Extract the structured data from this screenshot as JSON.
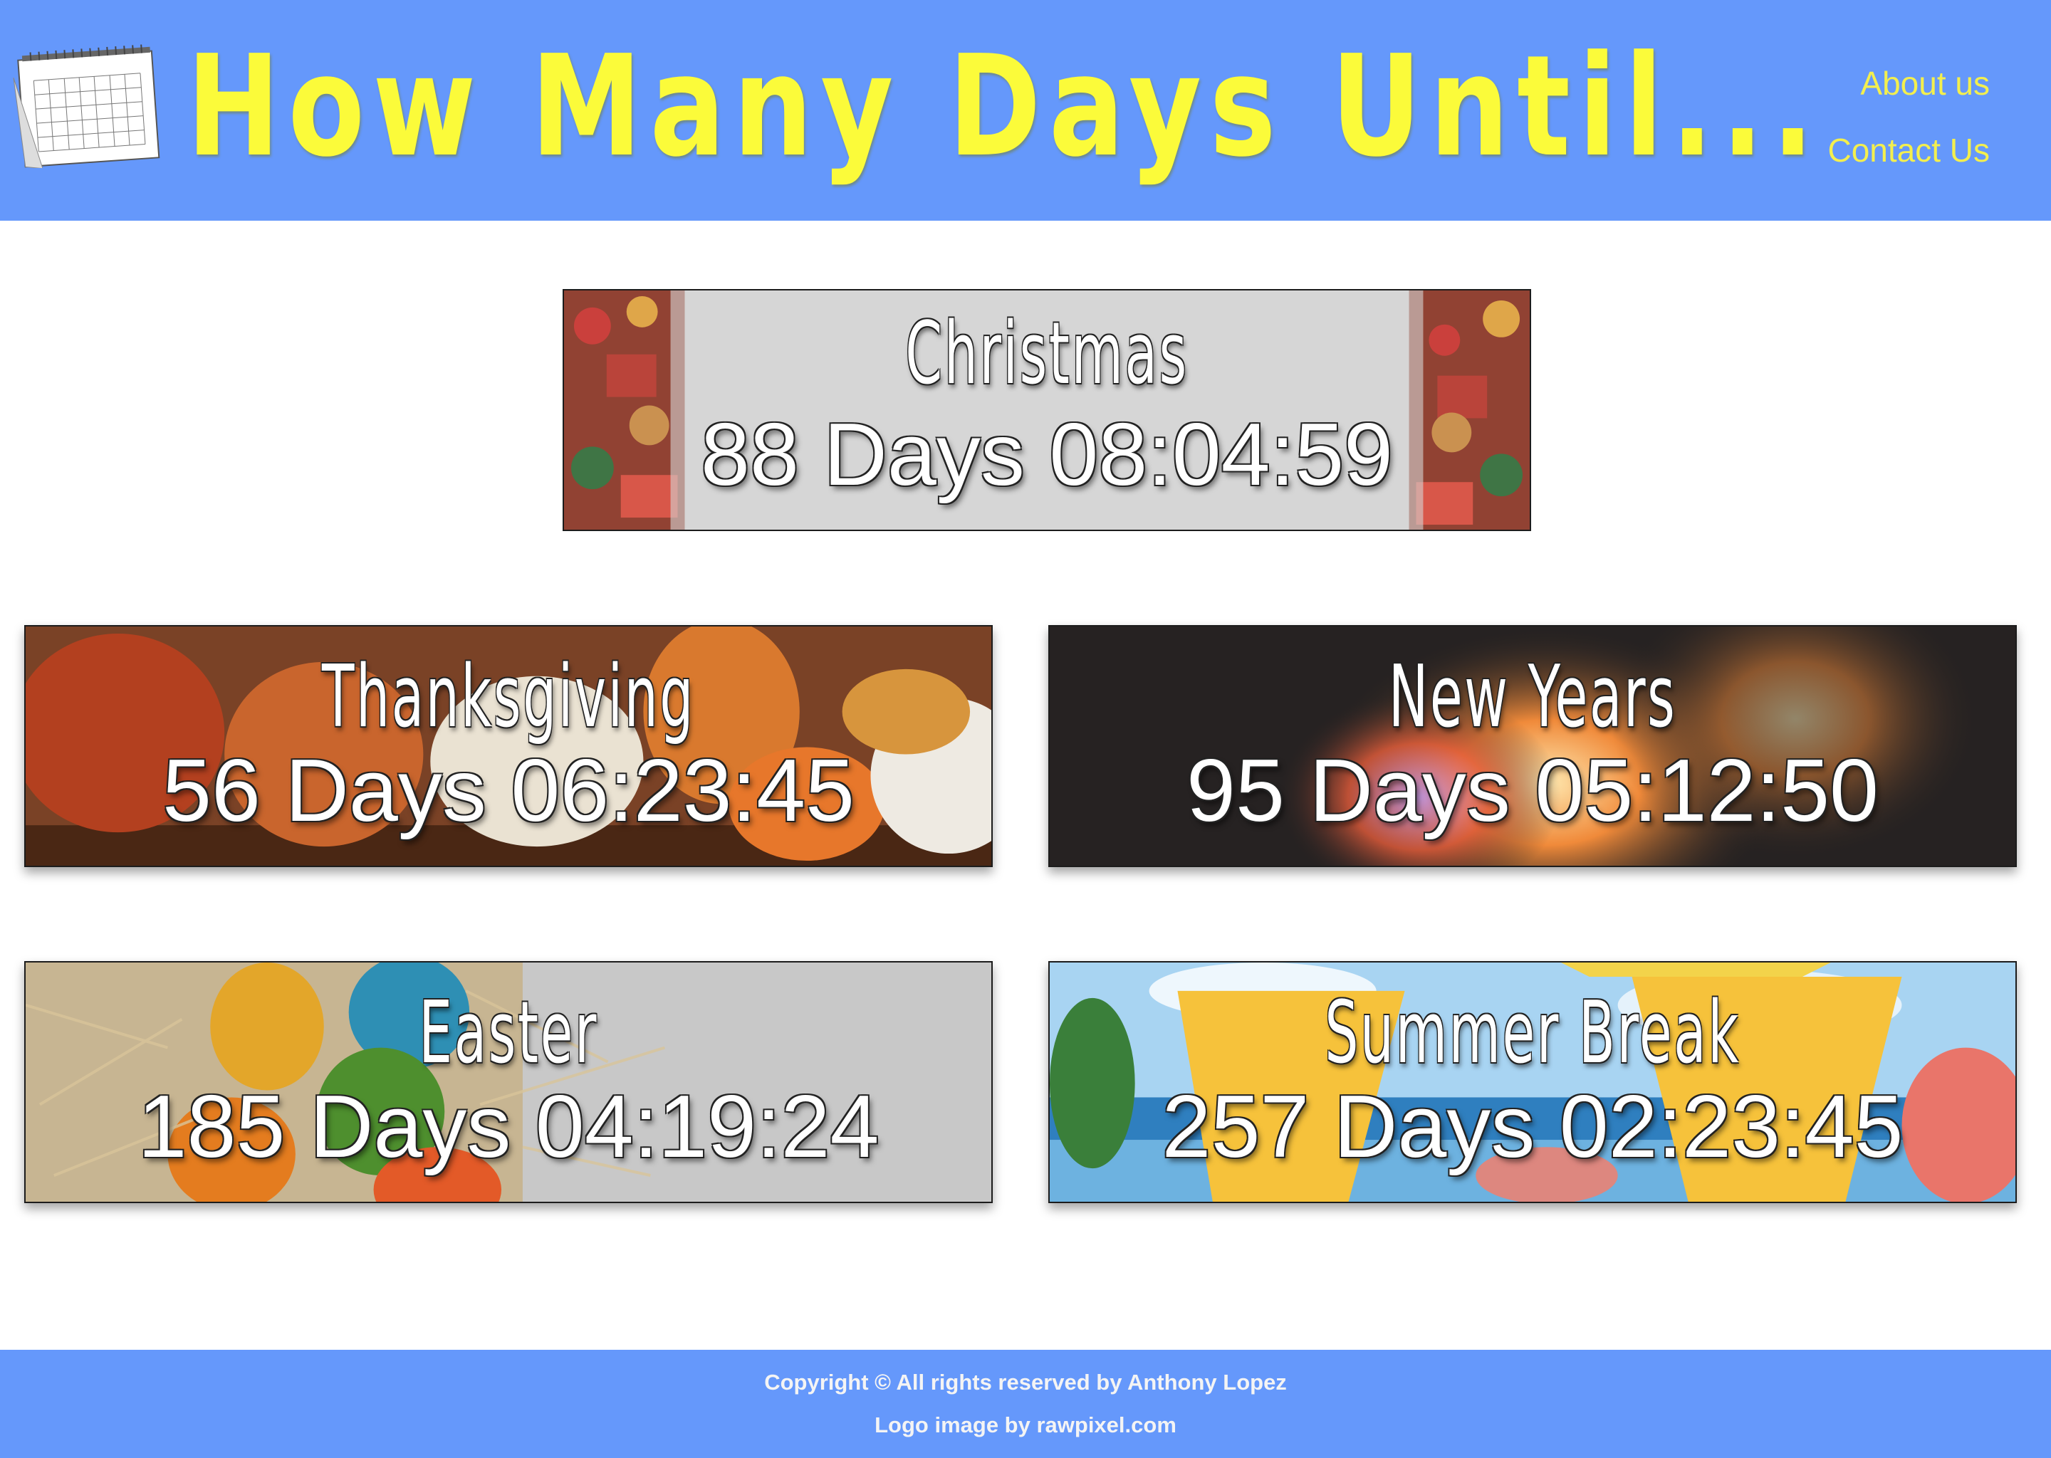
{
  "header": {
    "title": "How Many Days Until...",
    "nav": [
      {
        "label": "About us"
      },
      {
        "label": "Contact Us"
      }
    ],
    "colors": {
      "background": "#6598fb",
      "title": "#fbfb3a",
      "nav": "#f3ef4e"
    }
  },
  "cards": {
    "christmas": {
      "title": "Christmas",
      "countdown": "88 Days 08:04:59"
    },
    "thanksgiving": {
      "title": "Thanksgiving",
      "countdown": "56 Days 06:23:45"
    },
    "newyears": {
      "title": "New Years",
      "countdown": "95 Days 05:12:50"
    },
    "easter": {
      "title": "Easter",
      "countdown": "185 Days 04:19:24"
    },
    "summer": {
      "title": "Summer Break",
      "countdown": "257 Days 02:23:45"
    }
  },
  "footer": {
    "copyright": "Copyright © All rights reserved by Anthony Lopez",
    "credit": "Logo image by rawpixel.com"
  },
  "icons": {
    "logo": "calendar-icon"
  }
}
